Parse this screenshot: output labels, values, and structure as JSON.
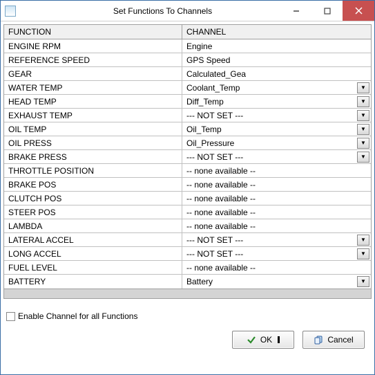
{
  "window": {
    "title": "Set Functions To Channels"
  },
  "grid": {
    "headers": {
      "function": "FUNCTION",
      "channel": "CHANNEL"
    },
    "rows": [
      {
        "func": "ENGINE RPM",
        "chan": "Engine",
        "dropdown": false
      },
      {
        "func": "REFERENCE SPEED",
        "chan": "GPS Speed",
        "dropdown": false
      },
      {
        "func": "GEAR",
        "chan": "Calculated_Gea",
        "dropdown": false
      },
      {
        "func": "WATER TEMP",
        "chan": "Coolant_Temp",
        "dropdown": true
      },
      {
        "func": "HEAD TEMP",
        "chan": "Diff_Temp",
        "dropdown": true
      },
      {
        "func": "EXHAUST TEMP",
        "chan": "--- NOT SET ---",
        "dropdown": true
      },
      {
        "func": "OIL TEMP",
        "chan": "Oil_Temp",
        "dropdown": true
      },
      {
        "func": "OIL  PRESS",
        "chan": "Oil_Pressure",
        "dropdown": true
      },
      {
        "func": "BRAKE PRESS",
        "chan": "--- NOT SET ---",
        "dropdown": true
      },
      {
        "func": "THROTTLE POSITION",
        "chan": "-- none available --",
        "dropdown": false
      },
      {
        "func": "BRAKE POS",
        "chan": "-- none available --",
        "dropdown": false
      },
      {
        "func": "CLUTCH  POS",
        "chan": "-- none available --",
        "dropdown": false
      },
      {
        "func": "STEER POS",
        "chan": "-- none available --",
        "dropdown": false
      },
      {
        "func": "LAMBDA",
        "chan": "-- none available --",
        "dropdown": false
      },
      {
        "func": "LATERAL  ACCEL",
        "chan": "--- NOT SET ---",
        "dropdown": true
      },
      {
        "func": "LONG ACCEL",
        "chan": "--- NOT SET ---",
        "dropdown": true
      },
      {
        "func": "FUEL LEVEL",
        "chan": "-- none available --",
        "dropdown": false
      },
      {
        "func": "BATTERY",
        "chan": "Battery",
        "dropdown": true
      }
    ]
  },
  "checkbox": {
    "label": "Enable Channel for all Functions"
  },
  "buttons": {
    "ok": "OK",
    "cancel": "Cancel"
  }
}
